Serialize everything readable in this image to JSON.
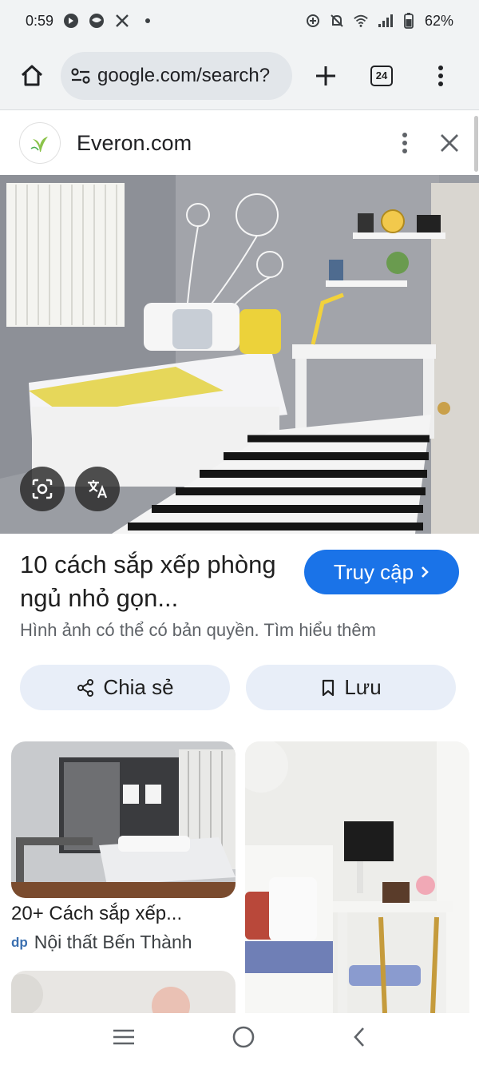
{
  "status_bar": {
    "time": "0:59",
    "battery": "62%"
  },
  "browser": {
    "url": "google.com/search?",
    "tab_count": "24"
  },
  "source": {
    "name": "Everon.com"
  },
  "result": {
    "title": "10 cách sắp xếp phòng ngủ nhỏ gọn...",
    "visit_label": "Truy cập",
    "copyright_text": "Hình ảnh có thể có bản quyền. Tìm hiểu thêm"
  },
  "actions": {
    "share_label": "Chia sẻ",
    "save_label": "Lưu"
  },
  "related": [
    {
      "title": "20+ Cách sắp xếp...",
      "source": "Nội thất Bến Thành",
      "source_logo": "dp"
    },
    {
      "title": "",
      "source": ""
    }
  ],
  "icons": [
    "home-icon",
    "site-settings-icon",
    "plus-icon",
    "tab-switcher-icon",
    "more-vert-icon",
    "close-icon",
    "lens-icon",
    "translate-icon",
    "share-icon",
    "bookmark-icon",
    "menu-icon",
    "home-circle-icon",
    "back-icon"
  ],
  "colors": {
    "accent": "#1a73e8",
    "pill": "#e8eef8",
    "toolbar": "#f1f3f4"
  }
}
